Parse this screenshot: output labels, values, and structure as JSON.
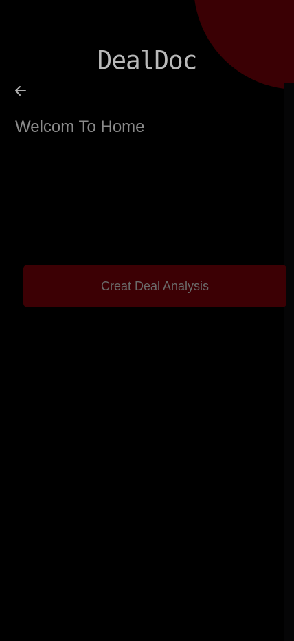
{
  "app": {
    "logo_text": "DealDoc"
  },
  "header": {
    "back_icon": "arrow-left-icon"
  },
  "main": {
    "title": "Welcom To Home",
    "cta_label": "Creat Deal Analysis"
  },
  "colors": {
    "background": "#000000",
    "accent": "#3c0004",
    "text_muted": "#8b8b8b"
  }
}
